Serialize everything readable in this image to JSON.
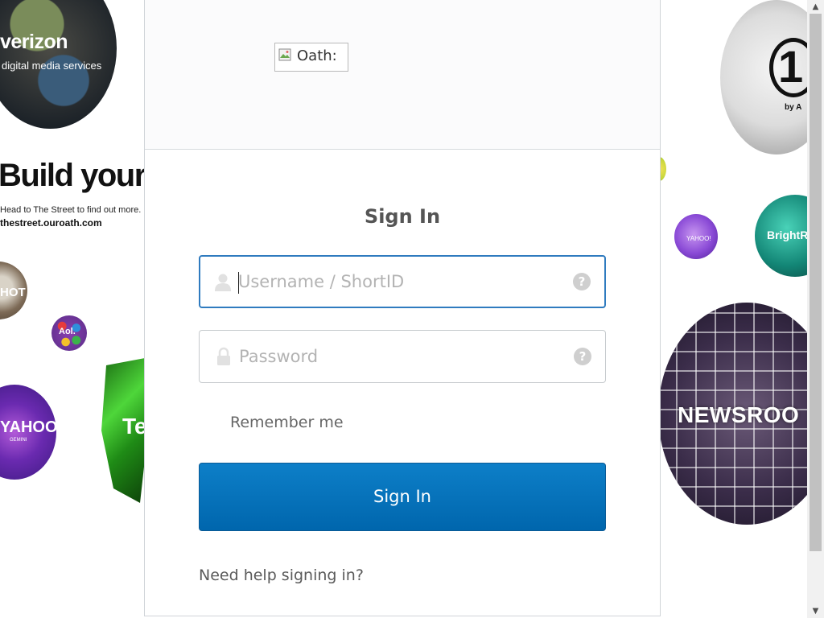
{
  "background": {
    "verizon": {
      "brand": "verizon",
      "tagline": "digital media services"
    },
    "promo": {
      "headline": "Build your",
      "subline": "Head to The Street to find out more.",
      "url": "thestreet.ouroath.com"
    },
    "orbs": {
      "hot": "HOT",
      "aol": "Aol.",
      "yahoo": "YAHOO!",
      "yahoo_sub": "GEMINI",
      "green": "Te",
      "one_number": "1",
      "one_by": "by A",
      "purple": "YAHOO!",
      "brightroll": "BrightR",
      "newsroom": "NEWSROO"
    }
  },
  "header": {
    "logo_alt": "Oath:"
  },
  "form": {
    "title": "Sign In",
    "username_placeholder": "Username / ShortID",
    "password_placeholder": "Password",
    "help_glyph": "?",
    "remember_label": "Remember me",
    "submit_label": "Sign In",
    "help_link": "Need help signing in?"
  },
  "colors": {
    "accent": "#0070bb",
    "focus_border": "#2f7bbf",
    "title_text": "#555555"
  },
  "icons": {
    "username": "user-icon",
    "password": "lock-icon",
    "help": "question-circle-icon",
    "logo": "broken-image-icon"
  }
}
